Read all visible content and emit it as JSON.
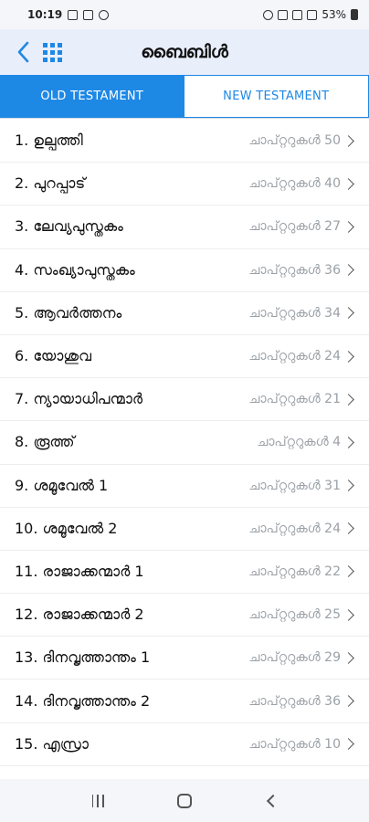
{
  "status_bar": {
    "time": "10:19",
    "battery": "53%"
  },
  "app_bar": {
    "title": "ബൈബിൾ"
  },
  "tabs": [
    {
      "label": "OLD TESTAMENT",
      "active": true
    },
    {
      "label": "NEW TESTAMENT",
      "active": false
    }
  ],
  "books": [
    {
      "name": "1. ഉല്പത്തി",
      "chapters": "ചാപ്റ്ററുകൾ 50"
    },
    {
      "name": "2. പുറപ്പാട്",
      "chapters": "ചാപ്റ്ററുകൾ 40"
    },
    {
      "name": "3. ലേവ്യപുസ്തകം",
      "chapters": "ചാപ്റ്ററുകൾ 27"
    },
    {
      "name": "4. സംഖ്യാപുസ്തകം",
      "chapters": "ചാപ്റ്ററുകൾ 36"
    },
    {
      "name": "5. ആവർത്തനം",
      "chapters": "ചാപ്റ്ററുകൾ 34"
    },
    {
      "name": "6. യോശുവ",
      "chapters": "ചാപ്റ്ററുകൾ 24"
    },
    {
      "name": "7. ന്യായാധിപന്മാർ",
      "chapters": "ചാപ്റ്ററുകൾ 21"
    },
    {
      "name": "8. രൂത്ത്",
      "chapters": "ചാപ്റ്ററുകൾ 4"
    },
    {
      "name": "9. ശമൂവേൽ 1",
      "chapters": "ചാപ്റ്ററുകൾ 31"
    },
    {
      "name": "10. ശമൂവേൽ 2",
      "chapters": "ചാപ്റ്ററുകൾ 24"
    },
    {
      "name": "11. രാജാക്കന്മാർ 1",
      "chapters": "ചാപ്റ്ററുകൾ 22"
    },
    {
      "name": "12. രാജാക്കന്മാർ 2",
      "chapters": "ചാപ്റ്ററുകൾ 25"
    },
    {
      "name": "13. ദിനവൃത്താന്തം 1",
      "chapters": "ചാപ്റ്ററുകൾ 29"
    },
    {
      "name": "14. ദിനവൃത്താന്തം 2",
      "chapters": "ചാപ്റ്ററുകൾ 36"
    },
    {
      "name": "15. എസ്രാ",
      "chapters": "ചാപ്റ്ററുകൾ 10"
    }
  ],
  "colors": {
    "accent": "#1e88e5",
    "app_bar_bg": "#e9eefb",
    "muted_text": "#9aa0a6"
  },
  "icons": {
    "back": "chevron-left-icon",
    "menu": "grid-menu-icon",
    "row": "chevron-right-icon"
  }
}
